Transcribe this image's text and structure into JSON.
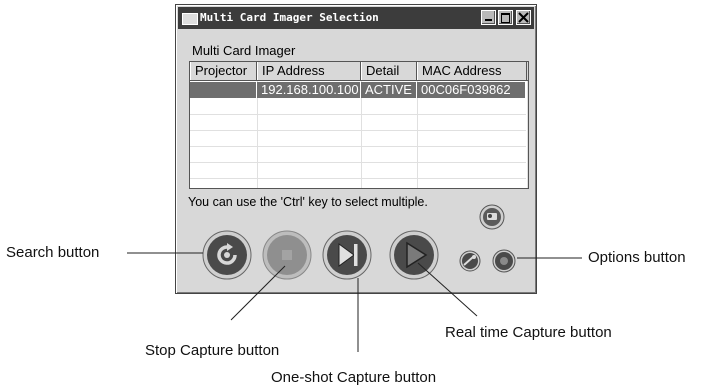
{
  "window": {
    "title": "Multi Card Imager Selection",
    "group_label": "Multi Card Imager",
    "columns": [
      "Projector",
      "IP Address",
      "Detail",
      "MAC Address"
    ],
    "rows": [
      {
        "projector": "",
        "ip": "192.168.100.100",
        "detail": "ACTIVE",
        "mac": "00C06F039862",
        "selected": true
      }
    ],
    "hint": "You can use the 'Ctrl' key to select multiple."
  },
  "buttons": {
    "search": "search-icon",
    "stop": "stop-icon",
    "oneshot": "oneshot-capture-icon",
    "realtime": "realtime-capture-icon",
    "options": "options-icon"
  },
  "callouts": {
    "search": "Search button",
    "stop": "Stop Capture button",
    "oneshot": "One-shot Capture button",
    "realtime": "Real time Capture button",
    "options": "Options button"
  },
  "colors": {
    "button_dark": "#4a4a4a",
    "button_disabled": "#8f8f8f",
    "selection": "#6e6e6e",
    "titlebar": "#3c3c3c"
  }
}
